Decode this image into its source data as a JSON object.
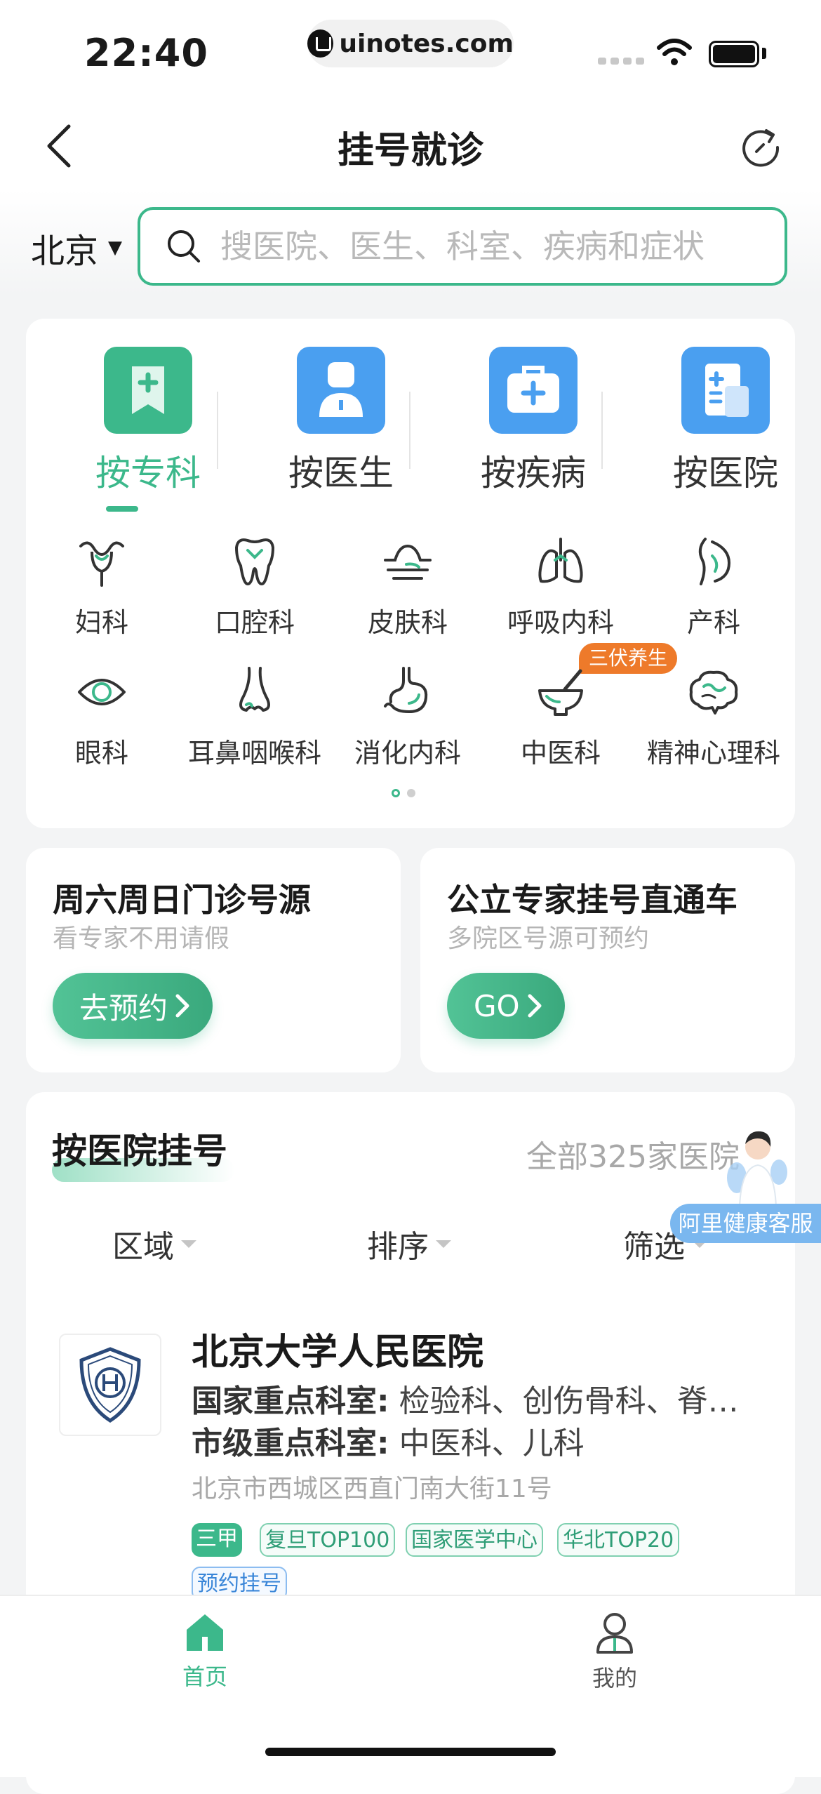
{
  "status_bar": {
    "time": "22:40",
    "url": "uinotes.com"
  },
  "header": {
    "title": "挂号就诊",
    "back_icon": "chevron-left-icon",
    "refresh_icon": "refresh-icon"
  },
  "search": {
    "city": "北京",
    "placeholder": "搜医院、医生、科室、疾病和症状"
  },
  "mode_tabs": [
    {
      "label": "按专科",
      "icon": "bookmark-plus-icon",
      "color": "#3cb88b",
      "active": true
    },
    {
      "label": "按医生",
      "icon": "doctor-icon",
      "color": "#4a9ff0",
      "active": false
    },
    {
      "label": "按疾病",
      "icon": "medical-kit-icon",
      "color": "#4a9ff0",
      "active": false
    },
    {
      "label": "按医院",
      "icon": "hospital-doc-icon",
      "color": "#4a9ff0",
      "active": false
    }
  ],
  "departments": [
    {
      "label": "妇科",
      "icon": "uterus-icon"
    },
    {
      "label": "口腔科",
      "icon": "tooth-icon"
    },
    {
      "label": "皮肤科",
      "icon": "skin-icon"
    },
    {
      "label": "呼吸内科",
      "icon": "lungs-icon"
    },
    {
      "label": "产科",
      "icon": "pregnancy-icon"
    },
    {
      "label": "眼科",
      "icon": "eye-icon"
    },
    {
      "label": "耳鼻咽喉科",
      "icon": "nose-icon"
    },
    {
      "label": "消化内科",
      "icon": "stomach-icon"
    },
    {
      "label": "中医科",
      "icon": "mortar-icon"
    },
    {
      "label": "精神心理科",
      "icon": "brain-icon"
    }
  ],
  "hot_badge": "三伏养生",
  "promos": [
    {
      "title": "周六周日门诊号源",
      "subtitle": "看专家不用请假",
      "button": "去预约"
    },
    {
      "title": "公立专家挂号直通车",
      "subtitle": "多院区号源可预约",
      "button": "GO"
    }
  ],
  "hospital_section": {
    "title": "按医院挂号",
    "all_link": "全部325家医院",
    "filters": [
      "区域",
      "排序",
      "筛选"
    ],
    "customer_service": "阿里健康客服"
  },
  "hospital": {
    "name": "北京大学人民医院",
    "national_label": "国家重点科室:",
    "national_value": "检验科、创伤骨科、脊…",
    "city_label": "市级重点科室:",
    "city_value": "中医科、儿科",
    "address": "北京市西城区西直门南大街11号",
    "tags": [
      "三甲",
      "复旦TOP100",
      "国家医学中心",
      "华北TOP20"
    ],
    "booking_tag": "预约挂号"
  },
  "tabbar": [
    {
      "label": "首页",
      "icon": "home-icon",
      "active": true
    },
    {
      "label": "我的",
      "icon": "user-icon",
      "active": false
    }
  ],
  "colors": {
    "accent": "#3cb88b",
    "blue": "#4a9ff0",
    "orange": "#ee7a2a"
  }
}
